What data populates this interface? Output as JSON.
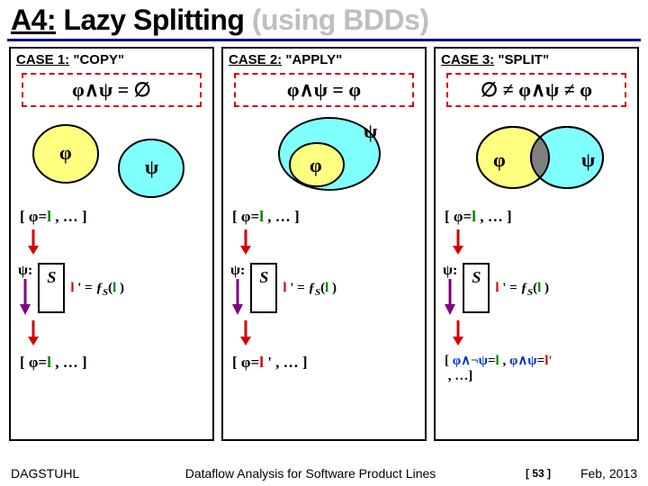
{
  "title": {
    "alg": "A4:",
    "main": " Lazy Splitting ",
    "gray": "(using BDDs)"
  },
  "cases": [
    {
      "key": "CASE 1:",
      "name": " \"COPY\"",
      "eq": "φ∧ψ = ∅",
      "row1": "[ φ=l , … ]",
      "s": "S",
      "psi": "ψ:",
      "lprime_lhs": "l ' = ",
      "lprime_rhs_fn": "ƒ",
      "lprime_rhs_sub": "S",
      "lprime_rhs_arg": "(l )",
      "row2": "[ φ=l , … ]"
    },
    {
      "key": "CASE 2:",
      "name": " \"APPLY\"",
      "eq": "φ∧ψ = φ",
      "row1": "[ φ=l , … ]",
      "s": "S",
      "psi": "ψ:",
      "lprime_lhs": "l ' = ",
      "lprime_rhs_fn": "ƒ",
      "lprime_rhs_sub": "S",
      "lprime_rhs_arg": "(l )",
      "row2": "[ φ=l ' , … ]"
    },
    {
      "key": "CASE 3:",
      "name": " \"SPLIT\"",
      "eq": "∅ ≠ φ∧ψ ≠ φ",
      "row1": "[ φ=l , … ]",
      "s": "S",
      "psi": "ψ:",
      "lprime_lhs": "l ' = ",
      "lprime_rhs_fn": "ƒ",
      "lprime_rhs_sub": "S",
      "lprime_rhs_arg": "(l )",
      "row2": "[ φ∧¬ψ=l , φ∧ψ=l' , …]"
    }
  ],
  "footer": {
    "left": "DAGSTUHL",
    "center": "Dataflow Analysis for Software Product Lines",
    "page": "[ 53 ]",
    "right": "Feb, 2013"
  }
}
